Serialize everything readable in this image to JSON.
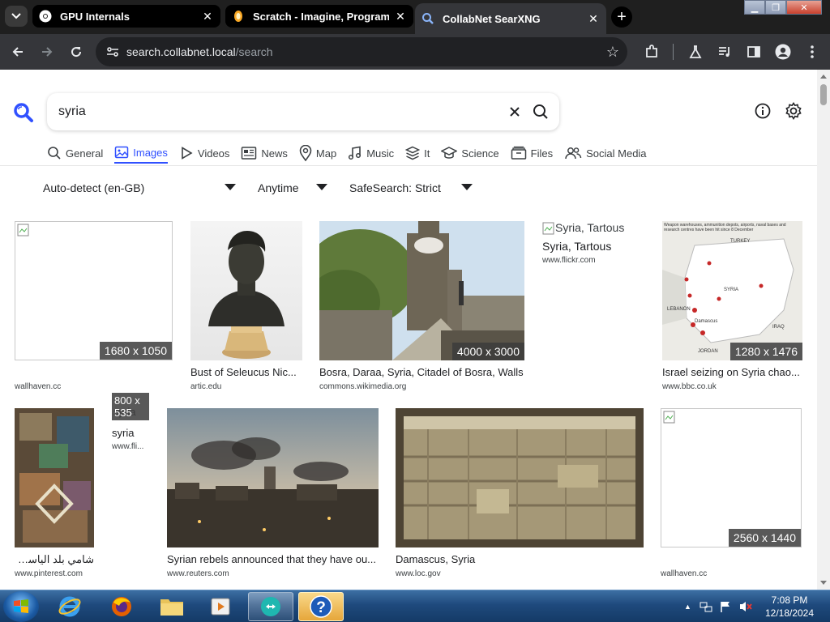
{
  "browser": {
    "tabs": [
      {
        "title": "GPU Internals",
        "favicon": "chrome-icon",
        "active": false
      },
      {
        "title": "Scratch - Imagine, Program, Sh",
        "favicon": "scratch-icon",
        "active": false
      },
      {
        "title": "CollabNet SearXNG",
        "favicon": "searxng-icon",
        "active": true
      }
    ],
    "new_tab_label": "+",
    "url_host": "search.collabnet.local",
    "url_path": "/search"
  },
  "search": {
    "query": "syria",
    "categories": [
      {
        "label": "General",
        "icon": "search-icon",
        "active": false
      },
      {
        "label": "Images",
        "icon": "image-icon",
        "active": true
      },
      {
        "label": "Videos",
        "icon": "play-icon",
        "active": false
      },
      {
        "label": "News",
        "icon": "newspaper-icon",
        "active": false
      },
      {
        "label": "Map",
        "icon": "map-pin-icon",
        "active": false
      },
      {
        "label": "Music",
        "icon": "music-icon",
        "active": false
      },
      {
        "label": "It",
        "icon": "layers-icon",
        "active": false
      },
      {
        "label": "Science",
        "icon": "graduation-cap-icon",
        "active": false
      },
      {
        "label": "Files",
        "icon": "files-icon",
        "active": false
      },
      {
        "label": "Social Media",
        "icon": "people-icon",
        "active": false
      }
    ],
    "filters": {
      "language": "Auto-detect (en-GB)",
      "time": "Anytime",
      "safesearch": "SafeSearch: Strict"
    }
  },
  "results": [
    {
      "title": "",
      "source": "wallhaven.cc",
      "dimensions": "1680 x 1050",
      "broken": true
    },
    {
      "title": "Bust of Seleucus Nic...",
      "source": "artic.edu",
      "dimensions": ""
    },
    {
      "title": "Bosra, Daraa, Syria, Citadel of Bosra, Walls",
      "source": "commons.wikimedia.org",
      "dimensions": "4000 x 3000"
    },
    {
      "title": "Syria, Tartous",
      "source": "www.flickr.com",
      "dimensions": "",
      "alt": "Syria, Tartous",
      "broken": true
    },
    {
      "title": "Israel seizing on Syria chao...",
      "source": "www.bbc.co.uk",
      "dimensions": "1280 x 1476"
    },
    {
      "title": "شامي بلد الياسمين",
      "source": "www.pinterest.com",
      "dimensions": ""
    },
    {
      "title": "syria",
      "source": "www.fli...",
      "dimensions": "800 x 535",
      "alt": "syria",
      "broken": true
    },
    {
      "title": "Syrian rebels announced that they have ou...",
      "source": "www.reuters.com",
      "dimensions": ""
    },
    {
      "title": "Damascus, Syria",
      "source": "www.loc.gov",
      "dimensions": ""
    },
    {
      "title": "",
      "source": "wallhaven.cc",
      "dimensions": "2560 x 1440",
      "broken": true
    }
  ],
  "map_labels": {
    "turkey": "TURKEY",
    "syria": "SYRIA",
    "lebanon": "LEBANON",
    "iraq": "IRAQ",
    "jordan": "JORDAN",
    "damascus": "Damascus",
    "header": "Weapon warehouses, ammunition depots, airports, naval bases and research centres have been hit since 8 December"
  },
  "taskbar": {
    "apps": [
      "ie-icon",
      "firefox-icon",
      "folder-icon",
      "media-player-icon",
      "teamviewer-icon",
      "help-icon"
    ],
    "time": "7:08 PM",
    "date": "12/18/2024"
  },
  "colors": {
    "accent": "#3050ff",
    "tab_bg": "#1f1f1f",
    "toolbar": "#35363a"
  }
}
